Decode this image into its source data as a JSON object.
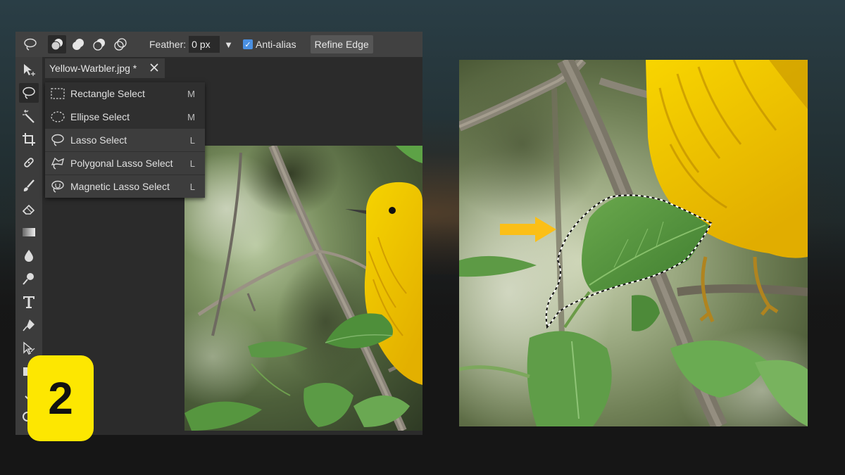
{
  "options": {
    "feather_label": "Feather:",
    "feather_value": "0 px",
    "antialias_label": "Anti-alias",
    "antialias_checked": true,
    "refine_label": "Refine Edge"
  },
  "document": {
    "tab_title": "Yellow-Warbler.jpg *"
  },
  "selection_menu": {
    "items": [
      {
        "label": "Rectangle Select",
        "shortcut": "M",
        "icon": "rectangle-select-icon"
      },
      {
        "label": "Ellipse Select",
        "shortcut": "M",
        "icon": "ellipse-select-icon"
      },
      {
        "label": "Lasso Select",
        "shortcut": "L",
        "icon": "lasso-icon"
      },
      {
        "label": "Polygonal Lasso Select",
        "shortcut": "L",
        "icon": "polygonal-lasso-icon"
      },
      {
        "label": "Magnetic Lasso Select",
        "shortcut": "L",
        "icon": "magnetic-lasso-icon"
      }
    ]
  },
  "step": {
    "number": "2"
  },
  "colors": {
    "accent_yellow": "#fde701",
    "arrow_yellow": "#fbbf17",
    "panel_dark": "#2b2b2b",
    "toolbar": "#3c3c3c",
    "checkbox_blue": "#4a90e2"
  }
}
